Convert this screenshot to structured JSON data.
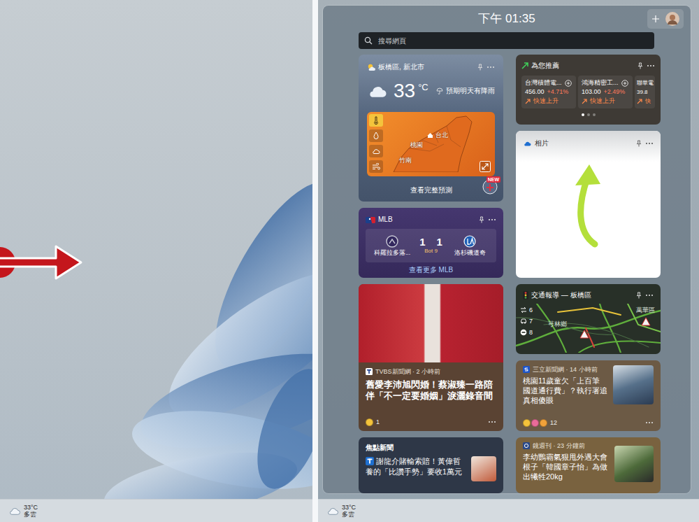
{
  "desktop_left": {
    "taskbar": {
      "temperature": "33°C",
      "condition": "多雲"
    }
  },
  "desktop_right": {
    "taskbar": {
      "temperature": "33°C",
      "condition": "多雲"
    }
  },
  "widgets": {
    "time": "下午 01:35",
    "search": {
      "placeholder": "搜尋網頁"
    },
    "weather": {
      "location": "板橋區, 新北市",
      "temperature": "33",
      "unit": "°C",
      "outlook": "預期明天有降雨",
      "layers": [
        {
          "selected": true
        },
        {
          "selected": false
        },
        {
          "selected": false
        },
        {
          "selected": false
        }
      ],
      "map_labels": [
        "桃園",
        "台北",
        "竹南"
      ],
      "link": "查看完整預測",
      "badge": "NEW"
    },
    "mlb": {
      "title": "MLB",
      "away": {
        "name": "科羅拉多落...",
        "score": "1"
      },
      "home": {
        "name": "洛杉磯道奇",
        "score": "1"
      },
      "status": "Bot 9",
      "link": "查看更多 MLB"
    },
    "stocks": {
      "title": "為您推薦",
      "items": [
        {
          "name": "台灣積體電...",
          "price": "456.00",
          "change": "+4.71%",
          "trend": "快速上升"
        },
        {
          "name": "鴻海精密工...",
          "price": "103.00",
          "change": "+2.49%",
          "trend": "快速上升"
        },
        {
          "name": "聯華電",
          "price": "39.8",
          "trend": "快"
        }
      ],
      "pages": [
        {
          "selected": true
        },
        {
          "selected": false
        },
        {
          "selected": false
        }
      ]
    },
    "photos": {
      "title": "相片"
    },
    "traffic": {
      "title": "交通報導 — 板橋區",
      "map_labels": [
        "萬華區",
        "芎林鄉"
      ],
      "incidents": [
        "6",
        "7",
        "8"
      ]
    },
    "top_story": {
      "source": "TVBS新聞網 · 2 小時前",
      "headline": "舊愛李沛旭閃婚！蔡淑臻一路陪伴「不一定要婚姻」淚灑錄音間",
      "reactions": "1"
    },
    "focus": {
      "title": "焦點新聞",
      "headline": "謝龍介賭輸索賠！黃偉哲養的「比讚手勢」要收1萬元"
    },
    "news": [
      {
        "source": "三立新聞網 · 14 小時前",
        "headline": "桃園11歲童欠「上百筆國道通行費」？執行署追真相傻眼",
        "reactions": "12"
      },
      {
        "source": "鏡週刊 · 23 分鐘前",
        "headline": "李幼鸚霸氣狠甩外遇大會根子「韓國章子怡」為做出犧牲20kg"
      }
    ]
  }
}
